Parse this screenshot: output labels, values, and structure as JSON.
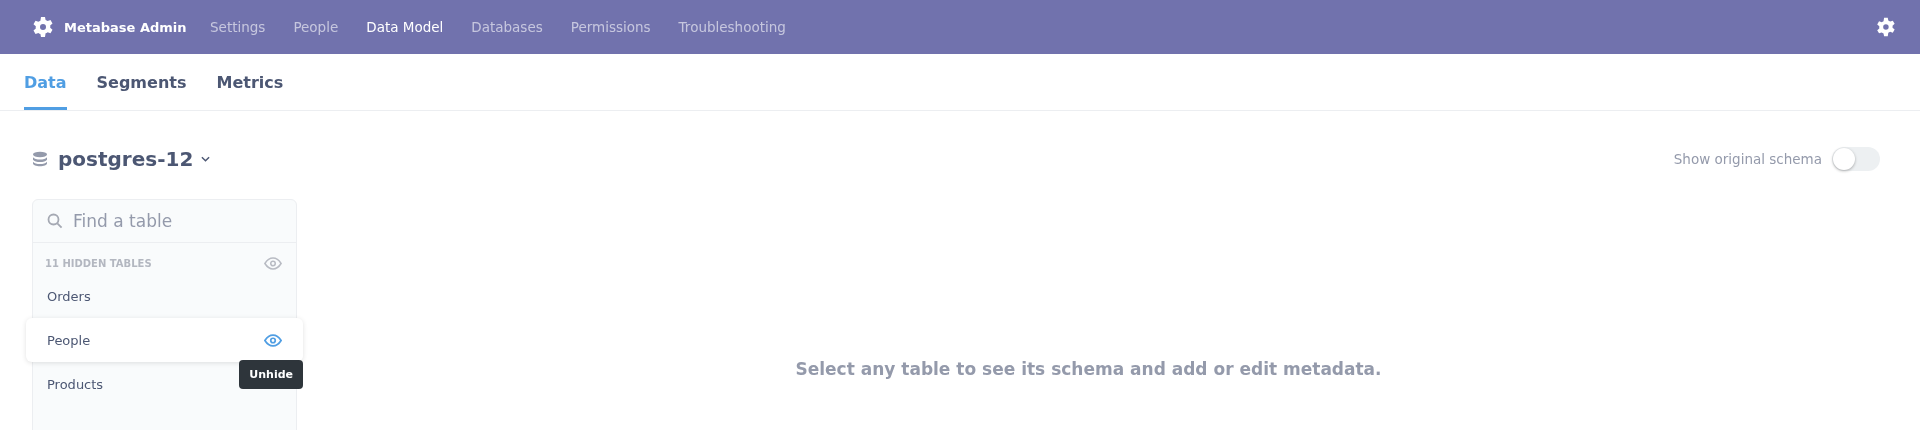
{
  "nav": {
    "brand": "Metabase Admin",
    "items": [
      {
        "label": "Settings",
        "selected": false
      },
      {
        "label": "People",
        "selected": false
      },
      {
        "label": "Data Model",
        "selected": true
      },
      {
        "label": "Databases",
        "selected": false
      },
      {
        "label": "Permissions",
        "selected": false
      },
      {
        "label": "Troubleshooting",
        "selected": false
      }
    ]
  },
  "tabs": [
    {
      "label": "Data",
      "selected": true
    },
    {
      "label": "Segments",
      "selected": false
    },
    {
      "label": "Metrics",
      "selected": false
    }
  ],
  "database": {
    "name": "postgres-12"
  },
  "schema_toggle": {
    "label": "Show original schema",
    "on": false
  },
  "sidebar": {
    "search": {
      "placeholder": "Find a table"
    },
    "hidden_section": {
      "label": "11 HIDDEN TABLES",
      "tooltip": "Unhide",
      "tables": [
        {
          "name": "Orders",
          "highlighted": false
        },
        {
          "name": "People",
          "highlighted": true
        },
        {
          "name": "Products",
          "highlighted": false
        }
      ]
    }
  },
  "empty_message": "Select any table to see its schema and add or edit metadata."
}
